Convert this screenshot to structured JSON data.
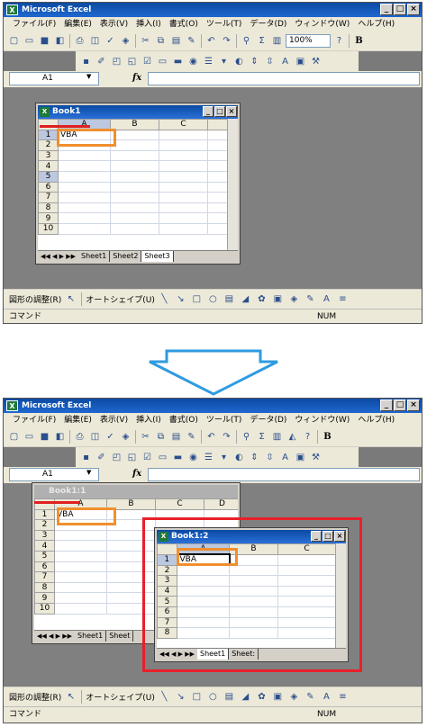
{
  "app": {
    "title": "Microsoft Excel",
    "menu": [
      "ファイル(F)",
      "編集(E)",
      "表示(V)",
      "挿入(I)",
      "書式(O)",
      "ツール(T)",
      "データ(D)",
      "ウィンドウ(W)",
      "ヘルプ(H)"
    ],
    "zoom": "100%",
    "bold_label": "B",
    "name_box": "A1",
    "fx_label": "fx",
    "draw_menu": "図形の調整(R)",
    "autoshape_menu": "オートシェイプ(U)",
    "status_left": "コマンド",
    "status_num": "NUM"
  },
  "top_panel": {
    "workbook": {
      "title": "Book1",
      "columns": [
        "A",
        "B",
        "C"
      ],
      "rows": [
        "1",
        "2",
        "3",
        "4",
        "5",
        "6",
        "7",
        "8",
        "9",
        "10"
      ],
      "cell_a1": "VBA",
      "sheet_tabs": [
        "Sheet1",
        "Sheet2",
        "Sheet3"
      ]
    }
  },
  "bottom_panel": {
    "workbook_1": {
      "title": "Book1:1",
      "columns": [
        "A",
        "B",
        "C",
        "D"
      ],
      "rows": [
        "1",
        "2",
        "3",
        "4",
        "5",
        "6",
        "7",
        "8",
        "9",
        "10"
      ],
      "cell_a1": "VBA",
      "sheet_tabs": [
        "Sheet1",
        "Sheet"
      ]
    },
    "workbook_2": {
      "title": "Book1:2",
      "columns": [
        "A",
        "B",
        "C"
      ],
      "rows": [
        "1",
        "2",
        "3",
        "4",
        "5",
        "6",
        "7",
        "8"
      ],
      "cell_a1": "VBA",
      "sheet_tabs": [
        "Sheet1",
        "Sheet:"
      ]
    }
  },
  "colors": {
    "title_bar": "#0b4aa3",
    "highlight_orange": "#f08f2f",
    "highlight_red": "#e8202a",
    "arrow": "#2e9be0"
  }
}
